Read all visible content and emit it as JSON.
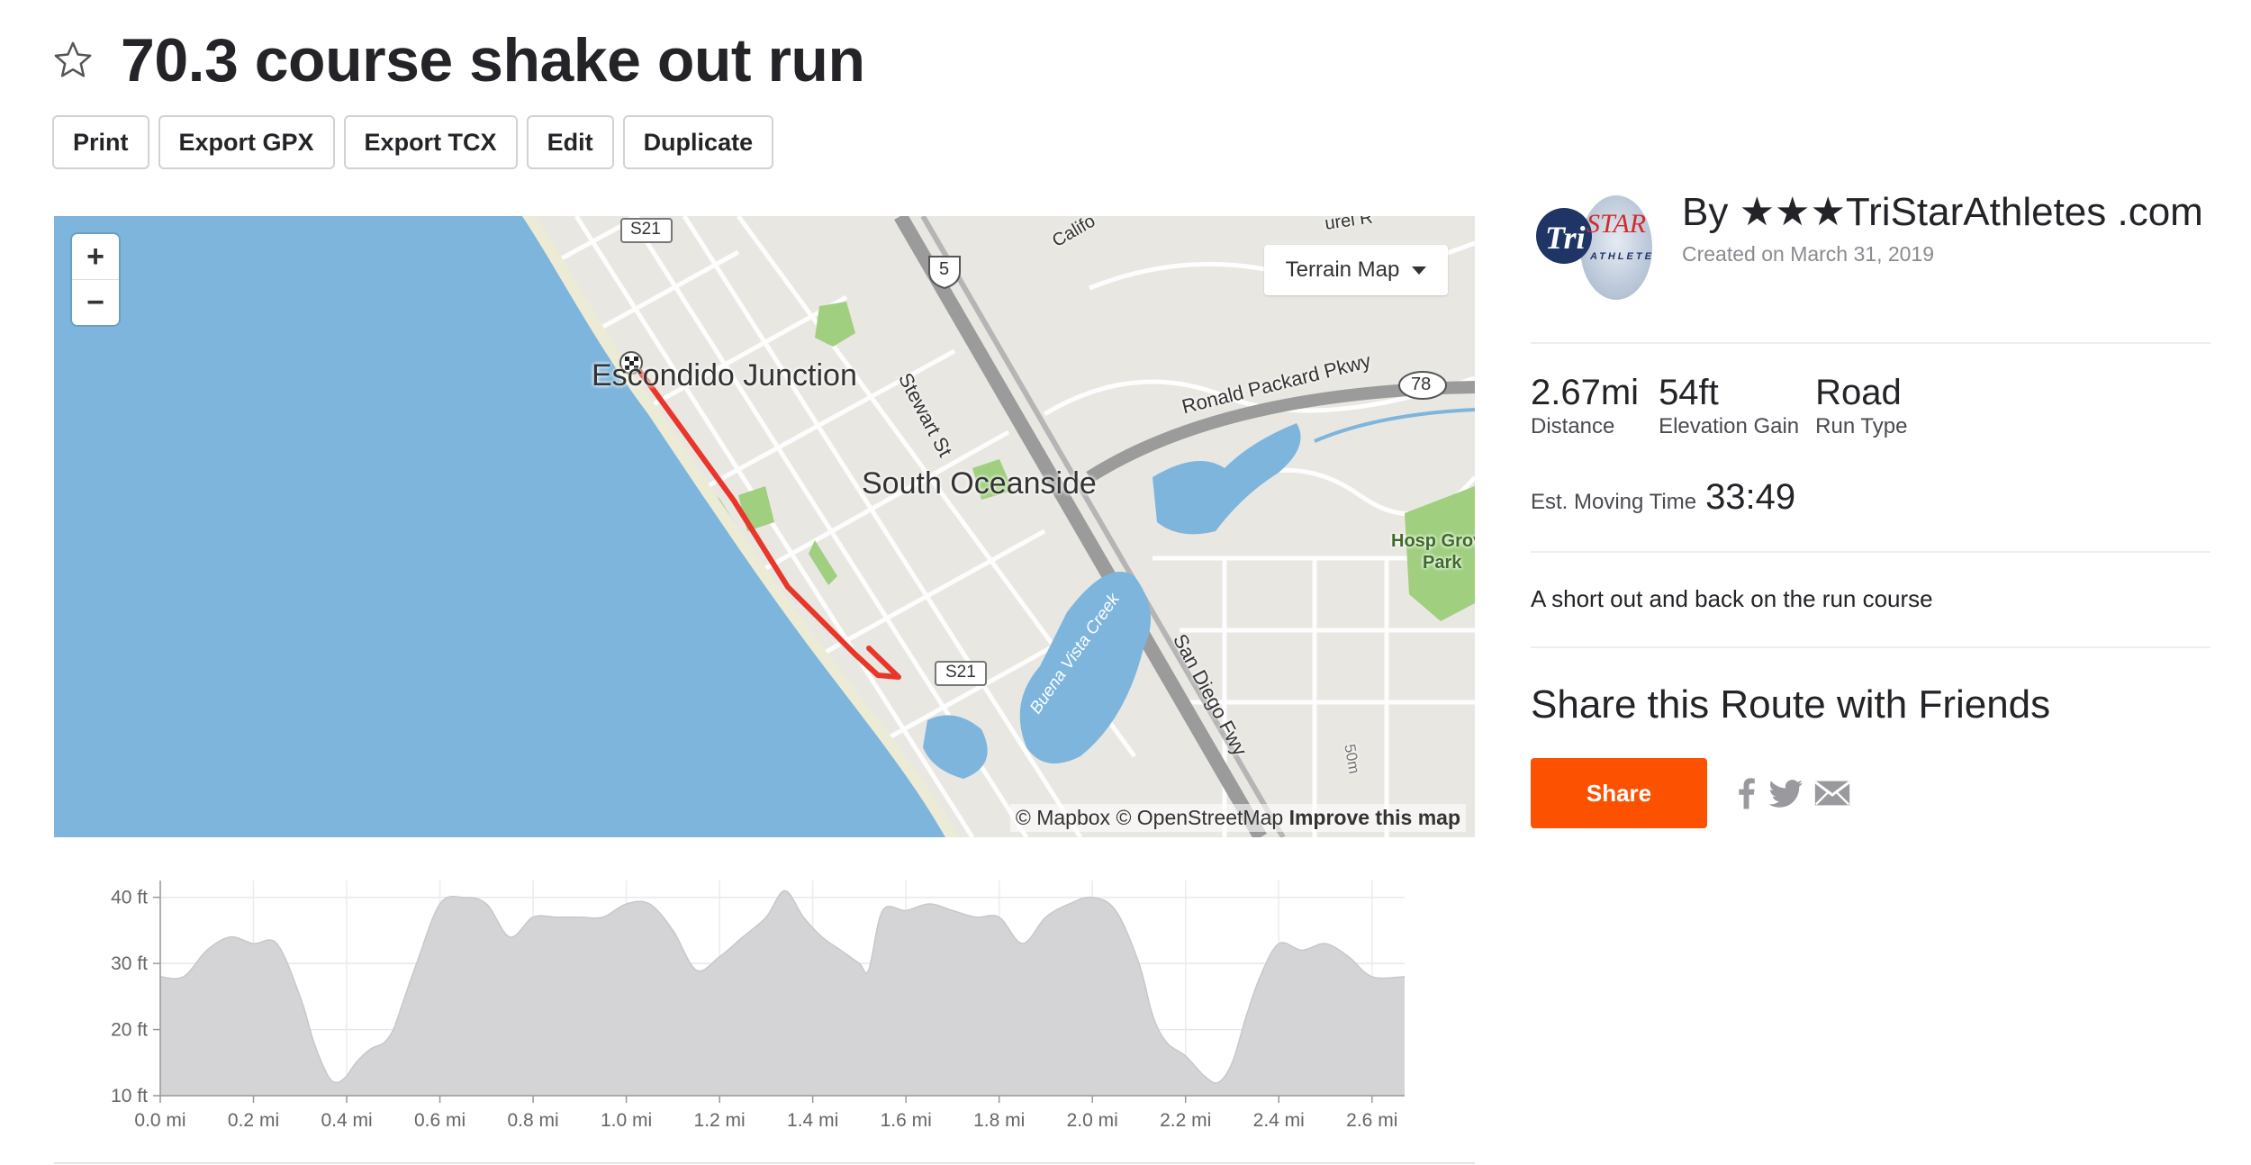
{
  "page": {
    "title": "70.3 course shake out run"
  },
  "toolbar": {
    "buttons": [
      "Print",
      "Export GPX",
      "Export TCX",
      "Edit",
      "Duplicate"
    ]
  },
  "map": {
    "zoom_in": "+",
    "zoom_out": "−",
    "layer_select": "Terrain Map",
    "labels": {
      "escondido": "Escondido Junction",
      "south_oceanside": "South Oceanside",
      "stewart": "Stewart St",
      "ronald": "Ronald Packard Pkwy",
      "sandiego": "San Diego Fwy",
      "buena": "Buena Vista Creek",
      "hosp": "Hosp Grove",
      "park": "Park",
      "california": "Califo",
      "laurel": "urel R",
      "fiftym": "50m",
      "s21_top": "S21",
      "s21_mid": "S21",
      "i5": "5",
      "r78": "78"
    },
    "attribution": {
      "mapbox": "© Mapbox",
      "osm": "© OpenStreetMap",
      "improve": "Improve this map"
    }
  },
  "author": {
    "name": "By ★★★TriStarAthletes .com",
    "created": "Created on March 31, 2019",
    "logo_text_tri": "Tri",
    "logo_text_star": "STAR",
    "logo_text_sub": "ATHLETE"
  },
  "stats": [
    {
      "value": "2.67mi",
      "label": "Distance"
    },
    {
      "value": "54ft",
      "label": "Elevation Gain"
    },
    {
      "value": "Road",
      "label": "Run Type"
    }
  ],
  "moving_time": {
    "label": "Est. Moving Time",
    "value": "33:49"
  },
  "description": "A short out and back on the run course",
  "share": {
    "title": "Share this Route with Friends",
    "button": "Share",
    "icons": [
      "facebook-icon",
      "twitter-icon",
      "email-icon"
    ]
  },
  "colors": {
    "accent": "#fc5200",
    "route": "#e8362a",
    "water": "#7db5dc",
    "land": "#e9e7e2",
    "park": "#9fcf7f"
  },
  "chart_data": {
    "type": "area",
    "x_unit": "mi",
    "y_unit": "ft",
    "xlim": [
      0,
      2.67
    ],
    "ylim": [
      10,
      42
    ],
    "x_ticks": [
      "0.0 mi",
      "0.2 mi",
      "0.4 mi",
      "0.6 mi",
      "0.8 mi",
      "1.0 mi",
      "1.2 mi",
      "1.4 mi",
      "1.6 mi",
      "1.8 mi",
      "2.0 mi",
      "2.2 mi",
      "2.4 mi",
      "2.6 mi"
    ],
    "y_ticks": [
      "10 ft",
      "20 ft",
      "30 ft",
      "40 ft"
    ],
    "x": [
      0.0,
      0.05,
      0.1,
      0.15,
      0.2,
      0.25,
      0.3,
      0.33,
      0.36,
      0.38,
      0.4,
      0.42,
      0.45,
      0.48,
      0.5,
      0.52,
      0.55,
      0.6,
      0.65,
      0.7,
      0.75,
      0.8,
      0.85,
      0.9,
      0.95,
      1.0,
      1.05,
      1.1,
      1.15,
      1.2,
      1.25,
      1.3,
      1.34,
      1.38,
      1.42,
      1.46,
      1.5,
      1.52,
      1.55,
      1.6,
      1.65,
      1.7,
      1.75,
      1.8,
      1.85,
      1.9,
      1.95,
      2.0,
      2.05,
      2.1,
      2.13,
      2.16,
      2.2,
      2.24,
      2.27,
      2.3,
      2.33,
      2.36,
      2.4,
      2.45,
      2.5,
      2.55,
      2.6,
      2.67
    ],
    "y": [
      28,
      28,
      32,
      34,
      33,
      33,
      25,
      18,
      13,
      12,
      13,
      15,
      17,
      18,
      20,
      24,
      30,
      39,
      40,
      39,
      34,
      37,
      37,
      37,
      37,
      39,
      39,
      35,
      29,
      31,
      34,
      37,
      41,
      37,
      34,
      32,
      30,
      29,
      38,
      38,
      39,
      38,
      37,
      37,
      33,
      37,
      39,
      40,
      38,
      30,
      22,
      18,
      16,
      13,
      12,
      15,
      22,
      28,
      33,
      32,
      33,
      31,
      28,
      28
    ]
  }
}
